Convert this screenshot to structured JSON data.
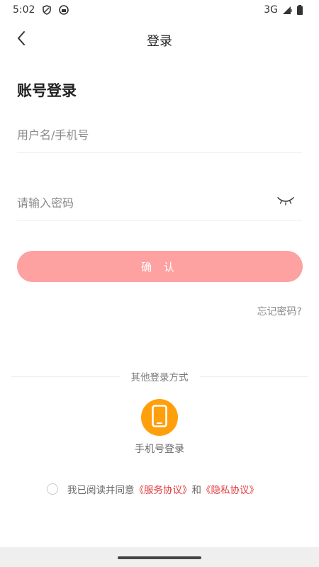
{
  "status_bar": {
    "time": "5:02",
    "network": "3G"
  },
  "nav": {
    "title": "登录"
  },
  "form": {
    "section_title": "账号登录",
    "username_placeholder": "用户名/手机号",
    "password_placeholder": "请输入密码",
    "confirm_label": "确 认",
    "forgot_label": "忘记密码?"
  },
  "other_login": {
    "divider_label": "其他登录方式",
    "phone_login_label": "手机号登录"
  },
  "agreement": {
    "prefix": "我已阅读并同意",
    "service_link": "《服务协议》",
    "and": "和",
    "privacy_link": "《隐私协议》"
  },
  "colors": {
    "confirm_button": "#fea1a1",
    "phone_icon_bg": "#ff9f0c",
    "link": "#e4393c"
  },
  "icons": {
    "back": "chevron-left-icon",
    "eye": "eye-closed-icon",
    "phone": "phone-icon"
  }
}
